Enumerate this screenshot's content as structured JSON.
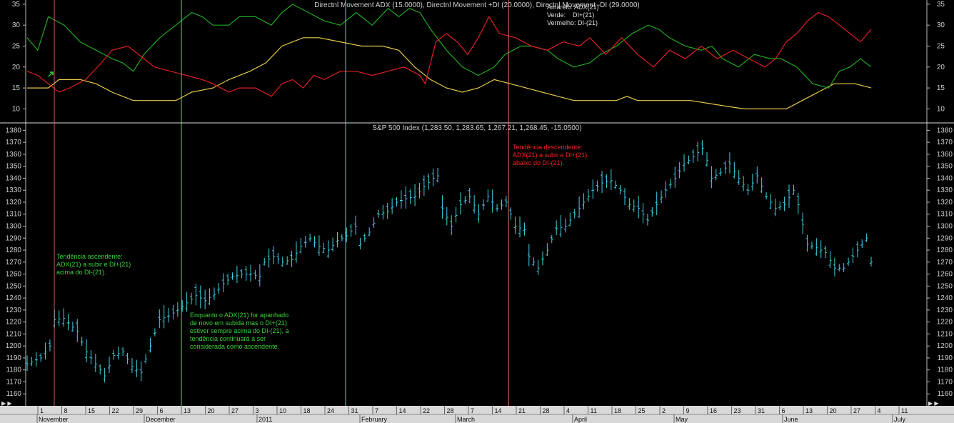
{
  "chart_data": [
    {
      "type": "line",
      "title": "Directnl Movement ADX (15.0000), Directnl Movement +DI (20.0000), Directnl Movement -DI (29.0000)",
      "ylim": [
        7,
        36
      ],
      "yticks": [
        10,
        15,
        20,
        25,
        30,
        35
      ],
      "legend": {
        "placement": "top-right",
        "entries": [
          "Amarelo: ADX(21)",
          "Verde:    DI+(21)",
          "Vermelho: DI-(21)"
        ]
      },
      "x_index_range": [
        0,
        150
      ],
      "series": [
        {
          "name": "ADX(21)",
          "color": "#e6c94a",
          "points": [
            [
              0,
              15
            ],
            [
              8,
              15
            ],
            [
              12,
              17
            ],
            [
              20,
              17
            ],
            [
              26,
              16
            ],
            [
              32,
              14
            ],
            [
              40,
              12
            ],
            [
              48,
              12
            ],
            [
              56,
              12
            ],
            [
              62,
              14
            ],
            [
              70,
              15
            ],
            [
              76,
              17
            ],
            [
              84,
              19
            ],
            [
              90,
              21
            ],
            [
              96,
              25
            ],
            [
              104,
              27
            ],
            [
              110,
              27
            ],
            [
              118,
              26
            ],
            [
              126,
              25
            ],
            [
              134,
              25
            ],
            [
              140,
              24
            ],
            [
              146,
              20
            ],
            [
              152,
              17
            ],
            [
              158,
              15
            ],
            [
              164,
              14
            ],
            [
              170,
              15
            ],
            [
              176,
              17
            ],
            [
              182,
              16
            ],
            [
              188,
              15
            ],
            [
              194,
              14
            ],
            [
              200,
              13
            ],
            [
              206,
              12
            ],
            [
              212,
              12
            ],
            [
              218,
              12
            ],
            [
              222,
              12
            ],
            [
              226,
              13
            ],
            [
              230,
              12
            ],
            [
              240,
              12
            ],
            [
              250,
              12
            ],
            [
              260,
              11
            ],
            [
              270,
              10
            ],
            [
              280,
              10
            ],
            [
              286,
              10
            ],
            [
              292,
              12
            ],
            [
              298,
              14
            ],
            [
              304,
              16
            ],
            [
              312,
              16
            ],
            [
              318,
              15
            ]
          ]
        },
        {
          "name": "DI+(21)",
          "color": "#1fa81f",
          "points": [
            [
              0,
              27
            ],
            [
              4,
              24
            ],
            [
              8,
              32
            ],
            [
              14,
              30
            ],
            [
              20,
              26
            ],
            [
              26,
              24
            ],
            [
              32,
              22
            ],
            [
              36,
              21
            ],
            [
              40,
              19
            ],
            [
              44,
              23
            ],
            [
              50,
              27
            ],
            [
              56,
              30
            ],
            [
              62,
              33
            ],
            [
              66,
              32
            ],
            [
              70,
              30
            ],
            [
              76,
              30
            ],
            [
              80,
              32
            ],
            [
              86,
              32
            ],
            [
              92,
              30
            ],
            [
              96,
              33
            ],
            [
              100,
              35
            ],
            [
              106,
              33
            ],
            [
              112,
              31
            ],
            [
              118,
              30
            ],
            [
              124,
              33
            ],
            [
              130,
              30
            ],
            [
              136,
              34
            ],
            [
              140,
              32
            ],
            [
              144,
              34
            ],
            [
              148,
              33
            ],
            [
              152,
              29
            ],
            [
              158,
              24
            ],
            [
              164,
              20
            ],
            [
              170,
              18
            ],
            [
              176,
              20
            ],
            [
              180,
              23
            ],
            [
              186,
              25
            ],
            [
              190,
              25
            ],
            [
              196,
              24
            ],
            [
              200,
              22
            ],
            [
              206,
              20
            ],
            [
              212,
              21
            ],
            [
              216,
              23
            ],
            [
              222,
              25
            ],
            [
              228,
              28
            ],
            [
              234,
              30
            ],
            [
              238,
              29
            ],
            [
              242,
              27
            ],
            [
              248,
              25
            ],
            [
              254,
              24
            ],
            [
              258,
              25
            ],
            [
              262,
              22
            ],
            [
              268,
              20
            ],
            [
              274,
              23
            ],
            [
              280,
              22
            ],
            [
              284,
              22
            ],
            [
              290,
              20
            ],
            [
              296,
              16
            ],
            [
              302,
              15
            ],
            [
              306,
              19
            ],
            [
              310,
              20
            ],
            [
              314,
              22
            ],
            [
              318,
              20
            ]
          ]
        },
        {
          "name": "DI-(21)",
          "color": "#e02020",
          "points": [
            [
              0,
              19
            ],
            [
              4,
              18
            ],
            [
              8,
              16
            ],
            [
              12,
              14
            ],
            [
              16,
              15
            ],
            [
              22,
              17
            ],
            [
              28,
              21
            ],
            [
              32,
              24
            ],
            [
              38,
              25
            ],
            [
              44,
              22
            ],
            [
              48,
              20
            ],
            [
              54,
              19
            ],
            [
              60,
              18
            ],
            [
              66,
              17
            ],
            [
              70,
              16
            ],
            [
              76,
              14
            ],
            [
              80,
              15
            ],
            [
              86,
              15
            ],
            [
              92,
              13
            ],
            [
              96,
              16
            ],
            [
              100,
              17
            ],
            [
              104,
              15
            ],
            [
              108,
              18
            ],
            [
              112,
              17
            ],
            [
              118,
              19
            ],
            [
              124,
              19
            ],
            [
              130,
              18
            ],
            [
              136,
              19
            ],
            [
              142,
              20
            ],
            [
              148,
              18
            ],
            [
              150,
              16
            ],
            [
              154,
              26
            ],
            [
              158,
              28
            ],
            [
              162,
              26
            ],
            [
              166,
              23
            ],
            [
              170,
              27
            ],
            [
              174,
              32
            ],
            [
              178,
              28
            ],
            [
              184,
              27
            ],
            [
              190,
              25
            ],
            [
              196,
              24
            ],
            [
              202,
              26
            ],
            [
              208,
              25
            ],
            [
              212,
              27
            ],
            [
              218,
              23
            ],
            [
              224,
              27
            ],
            [
              230,
              23
            ],
            [
              236,
              20
            ],
            [
              242,
              24
            ],
            [
              248,
              22
            ],
            [
              254,
              25
            ],
            [
              260,
              22
            ],
            [
              266,
              24
            ],
            [
              272,
              22
            ],
            [
              278,
              20
            ],
            [
              282,
              22
            ],
            [
              286,
              26
            ],
            [
              290,
              28
            ],
            [
              294,
              31
            ],
            [
              298,
              33
            ],
            [
              302,
              32
            ],
            [
              306,
              30
            ],
            [
              310,
              28
            ],
            [
              314,
              26
            ],
            [
              318,
              29
            ]
          ]
        }
      ]
    },
    {
      "type": "ohlc",
      "title": "S&P 500 Index (1,283.50, 1,283.65, 1,267.21, 1,268.45, -15.0500)",
      "ylim": [
        1150,
        1385
      ],
      "yticks": [
        1160,
        1170,
        1180,
        1190,
        1200,
        1210,
        1220,
        1230,
        1240,
        1250,
        1260,
        1270,
        1280,
        1290,
        1300,
        1310,
        1320,
        1330,
        1340,
        1350,
        1360,
        1370,
        1380
      ],
      "color": "#3fd2e6",
      "close_path": [
        [
          0,
          1185
        ],
        [
          6,
          1190
        ],
        [
          10,
          1200
        ],
        [
          12,
          1222
        ],
        [
          16,
          1223
        ],
        [
          22,
          1212
        ],
        [
          26,
          1195
        ],
        [
          30,
          1185
        ],
        [
          34,
          1175
        ],
        [
          38,
          1192
        ],
        [
          42,
          1195
        ],
        [
          46,
          1183
        ],
        [
          50,
          1178
        ],
        [
          54,
          1200
        ],
        [
          58,
          1222
        ],
        [
          62,
          1225
        ],
        [
          66,
          1230
        ],
        [
          70,
          1236
        ],
        [
          74,
          1242
        ],
        [
          78,
          1238
        ],
        [
          82,
          1243
        ],
        [
          86,
          1252
        ],
        [
          90,
          1258
        ],
        [
          94,
          1260
        ],
        [
          98,
          1260
        ],
        [
          102,
          1258
        ],
        [
          104,
          1270
        ],
        [
          108,
          1275
        ],
        [
          112,
          1270
        ],
        [
          116,
          1272
        ],
        [
          120,
          1283
        ],
        [
          124,
          1290
        ],
        [
          128,
          1283
        ],
        [
          132,
          1280
        ],
        [
          136,
          1288
        ],
        [
          140,
          1292
        ],
        [
          144,
          1300
        ],
        [
          146,
          1285
        ],
        [
          150,
          1295
        ],
        [
          154,
          1310
        ],
        [
          158,
          1312
        ],
        [
          162,
          1320
        ],
        [
          166,
          1323
        ],
        [
          170,
          1325
        ],
        [
          174,
          1333
        ],
        [
          178,
          1340
        ],
        [
          180,
          1342
        ],
        [
          182,
          1315
        ],
        [
          186,
          1300
        ],
        [
          190,
          1318
        ],
        [
          194,
          1325
        ],
        [
          198,
          1310
        ],
        [
          202,
          1325
        ],
        [
          206,
          1315
        ],
        [
          210,
          1320
        ],
        [
          214,
          1300
        ],
        [
          218,
          1297
        ],
        [
          220,
          1275
        ],
        [
          224,
          1265
        ],
        [
          228,
          1280
        ],
        [
          232,
          1298
        ],
        [
          236,
          1300
        ],
        [
          240,
          1310
        ],
        [
          244,
          1320
        ],
        [
          248,
          1330
        ],
        [
          252,
          1336
        ],
        [
          256,
          1338
        ],
        [
          260,
          1330
        ],
        [
          264,
          1318
        ],
        [
          268,
          1315
        ],
        [
          272,
          1305
        ],
        [
          276,
          1318
        ],
        [
          280,
          1330
        ],
        [
          284,
          1340
        ],
        [
          288,
          1352
        ],
        [
          292,
          1358
        ],
        [
          296,
          1365
        ],
        [
          298,
          1355
        ],
        [
          300,
          1340
        ],
        [
          304,
          1345
        ],
        [
          308,
          1352
        ],
        [
          312,
          1340
        ],
        [
          316,
          1330
        ],
        [
          320,
          1342
        ],
        [
          324,
          1325
        ],
        [
          328,
          1315
        ],
        [
          332,
          1318
        ],
        [
          336,
          1330
        ],
        [
          338,
          1318
        ],
        [
          342,
          1285
        ],
        [
          346,
          1282
        ],
        [
          350,
          1278
        ],
        [
          354,
          1265
        ],
        [
          358,
          1265
        ],
        [
          362,
          1275
        ],
        [
          366,
          1285
        ],
        [
          368,
          1290
        ],
        [
          370,
          1270
        ]
      ],
      "annotations": [
        {
          "lines": [
            "Tendência ascendente:",
            "ADX(21) a subir e DI+(21)",
            "acima do DI-(21)."
          ],
          "color": "#3bd23b"
        },
        {
          "lines": [
            "Enquanto o ADX(21) for apanhado",
            "de novo em subida mas o DI+(21)",
            "estiver sempre acima do DI-(21), a",
            "tendência continuará a ser",
            "considerada como ascendente."
          ],
          "color": "#3bd23b"
        },
        {
          "lines": [
            "Tendência descendente:",
            "ADX(21) a subir e DI+(21)",
            "abaixo do DI-(21)."
          ],
          "color": "#ff2020"
        }
      ],
      "vertical_markers": [
        {
          "color": "#e06070"
        },
        {
          "color": "#80e080"
        },
        {
          "color": "#60e6e6"
        },
        {
          "color": "#ff8060"
        }
      ]
    }
  ],
  "x_axis": {
    "day_ticks": [
      "1",
      "8",
      "15",
      "22",
      "29",
      "6",
      "13",
      "20",
      "27",
      "3",
      "10",
      "18",
      "24",
      "31",
      "7",
      "14",
      "22",
      "28",
      "7",
      "14",
      "21",
      "28",
      "4",
      "11",
      "18",
      "25",
      "2",
      "9",
      "16",
      "23",
      "31",
      "6",
      "13",
      "20",
      "27",
      "4",
      "11"
    ],
    "month_labels": [
      "November",
      "December",
      "2011",
      "February",
      "March",
      "April",
      "May",
      "June",
      "July"
    ]
  },
  "corner_labels": {
    "left": "▶ ▶",
    "right": "▶ ▶"
  }
}
